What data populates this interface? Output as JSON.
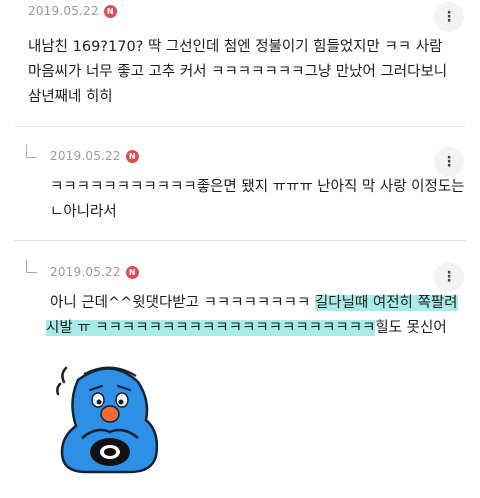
{
  "comments": [
    {
      "date": "2019.05.22",
      "badge": "N",
      "text_lines": [
        "내남친 169?170? 딱 그선인데 첨엔 정불이기 힘들었지만 ㅋㅋ 사람",
        "마음씨가 너무 좋고 고추 커서 ㅋㅋㅋㅋㅋㅋㅋ그냥 만났어 그러다보니",
        "삼년째네 히히"
      ],
      "more": "⋮"
    },
    {
      "date": "2019.05.22",
      "badge": "N",
      "text_lines": [
        "ㅋㅋㅋㅋㅋㅋㅋㅋㅋㅋㅋ좋은면 됐지 ㅠㅠㅠ 난아직 막 사랑 이정도는",
        "ㄴ아니라서"
      ],
      "more": "⋮"
    },
    {
      "date": "2019.05.22",
      "badge": "N",
      "line1_plain": "아니 근데^^윗댓다받고 ㅋㅋㅋㅋㅋㅋㅋㅋ ",
      "line1_highlight": "길다닐때 여전히 쪽팔려",
      "line2_highlight": "시발 ㅠ ㅋㅋㅋㅋㅋㅋㅋㅋㅋㅋㅋㅋㅋㅋㅋㅋㅋㅋㅋㅋㅋ",
      "line2_plain": "힐도 못신어",
      "highlight_color": "#a8ece8",
      "more": "⋮"
    }
  ],
  "sticker": {
    "name": "blue-character-sticker"
  }
}
